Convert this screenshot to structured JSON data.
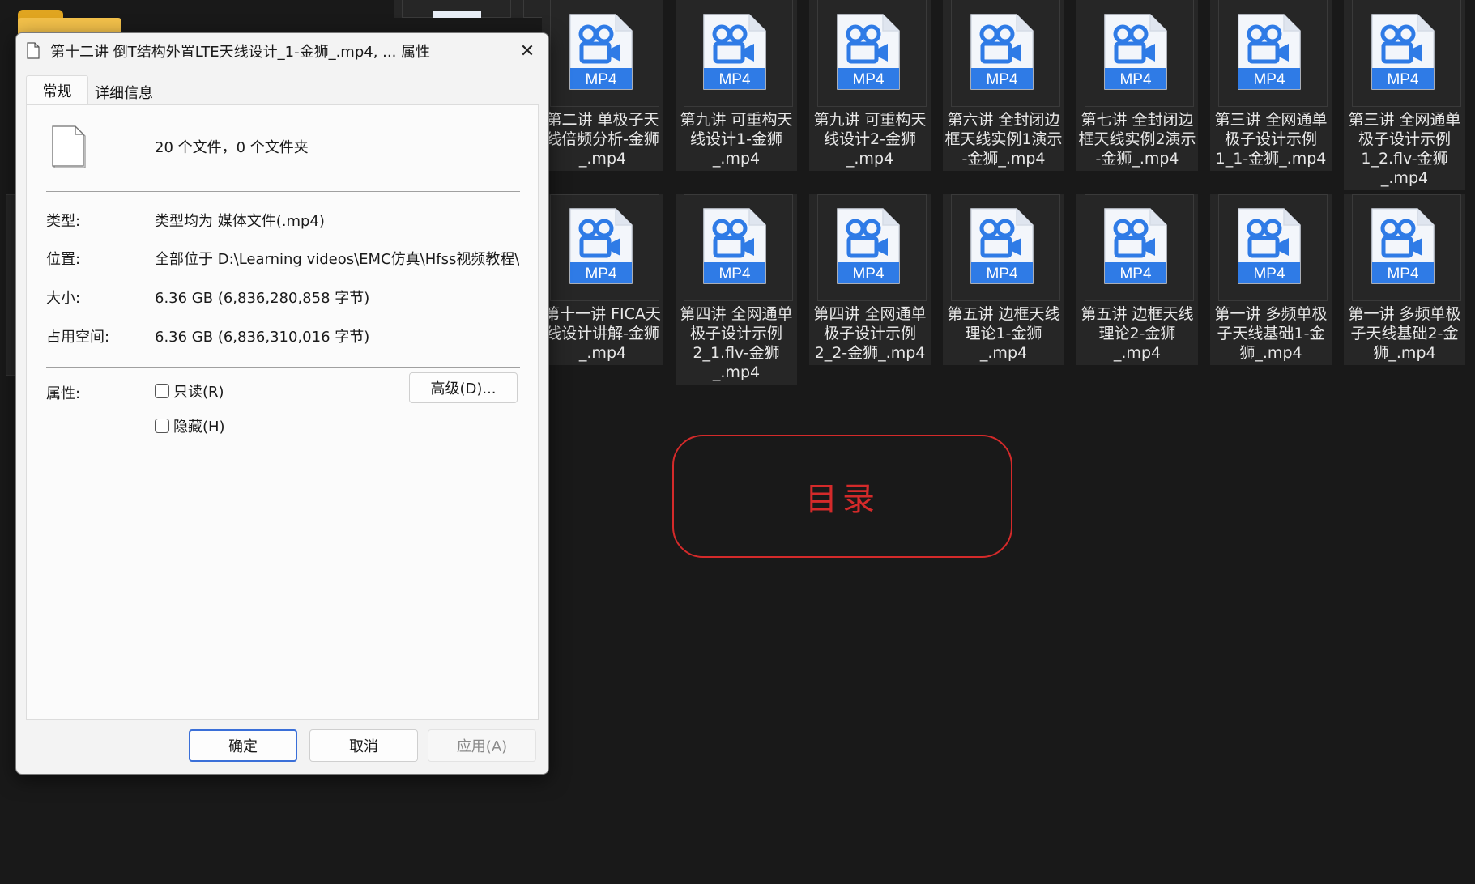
{
  "dialog": {
    "title": "第十二讲 倒T结构外置LTE天线设计_1-金狮_.mp4, ... 属性",
    "close_glyph": "✕",
    "tabs": [
      {
        "label": "常规"
      },
      {
        "label": "详细信息"
      }
    ],
    "summary": "20 个文件，0 个文件夹",
    "rows": [
      {
        "label": "类型:",
        "value": "类型均为 媒体文件(.mp4)"
      },
      {
        "label": "位置:",
        "value": "全部位于 D:\\Learning videos\\EMC仿真\\Hfss视频教程\\H"
      },
      {
        "label": "大小:",
        "value": "6.36 GB (6,836,280,858 字节)"
      },
      {
        "label": "占用空间:",
        "value": "6.36 GB (6,836,310,016 字节)"
      }
    ],
    "attributes_label": "属性:",
    "readonly_label": "只读(R)",
    "hidden_label": "隐藏(H)",
    "advanced_label": "高级(D)...",
    "buttons": {
      "ok": "确定",
      "cancel": "取消",
      "apply": "应用(A)"
    }
  },
  "explorer": {
    "badge_text": "MP4",
    "accent_color": "#2f7be6",
    "files_row1": [
      "第二讲 单极子天\n线倍频分析-金狮\n_.mp4",
      "第九讲 可重构天\n线设计1-金狮\n_.mp4",
      "第九讲 可重构天\n线设计2-金狮\n_.mp4",
      "第六讲 全封闭边\n框天线实例1演示\n-金狮_.mp4",
      "第七讲 全封闭边\n框天线实例2演示\n-金狮_.mp4",
      "第三讲 全网通单\n极子设计示例\n1_1-金狮_.mp4",
      "第三讲 全网通单\n极子设计示例\n1_2.flv-金狮\n_.mp4"
    ],
    "files_row2": [
      "第十一讲 FICA天\n线设计讲解-金狮\n_.mp4",
      "第四讲 全网通单\n极子设计示例\n2_1.flv-金狮\n_.mp4",
      "第四讲 全网通单\n极子设计示例\n2_2-金狮_.mp4",
      "第五讲 边框天线\n理论1-金狮\n_.mp4",
      "第五讲 边框天线\n理论2-金狮\n_.mp4",
      "第一讲 多频单极\n子天线基础1-金\n狮_.mp4",
      "第一讲 多频单极\n子天线基础2-金\n狮_.mp4"
    ]
  },
  "overlay": {
    "mulu_text": "目录",
    "mulu_color": "#d42a2a"
  }
}
